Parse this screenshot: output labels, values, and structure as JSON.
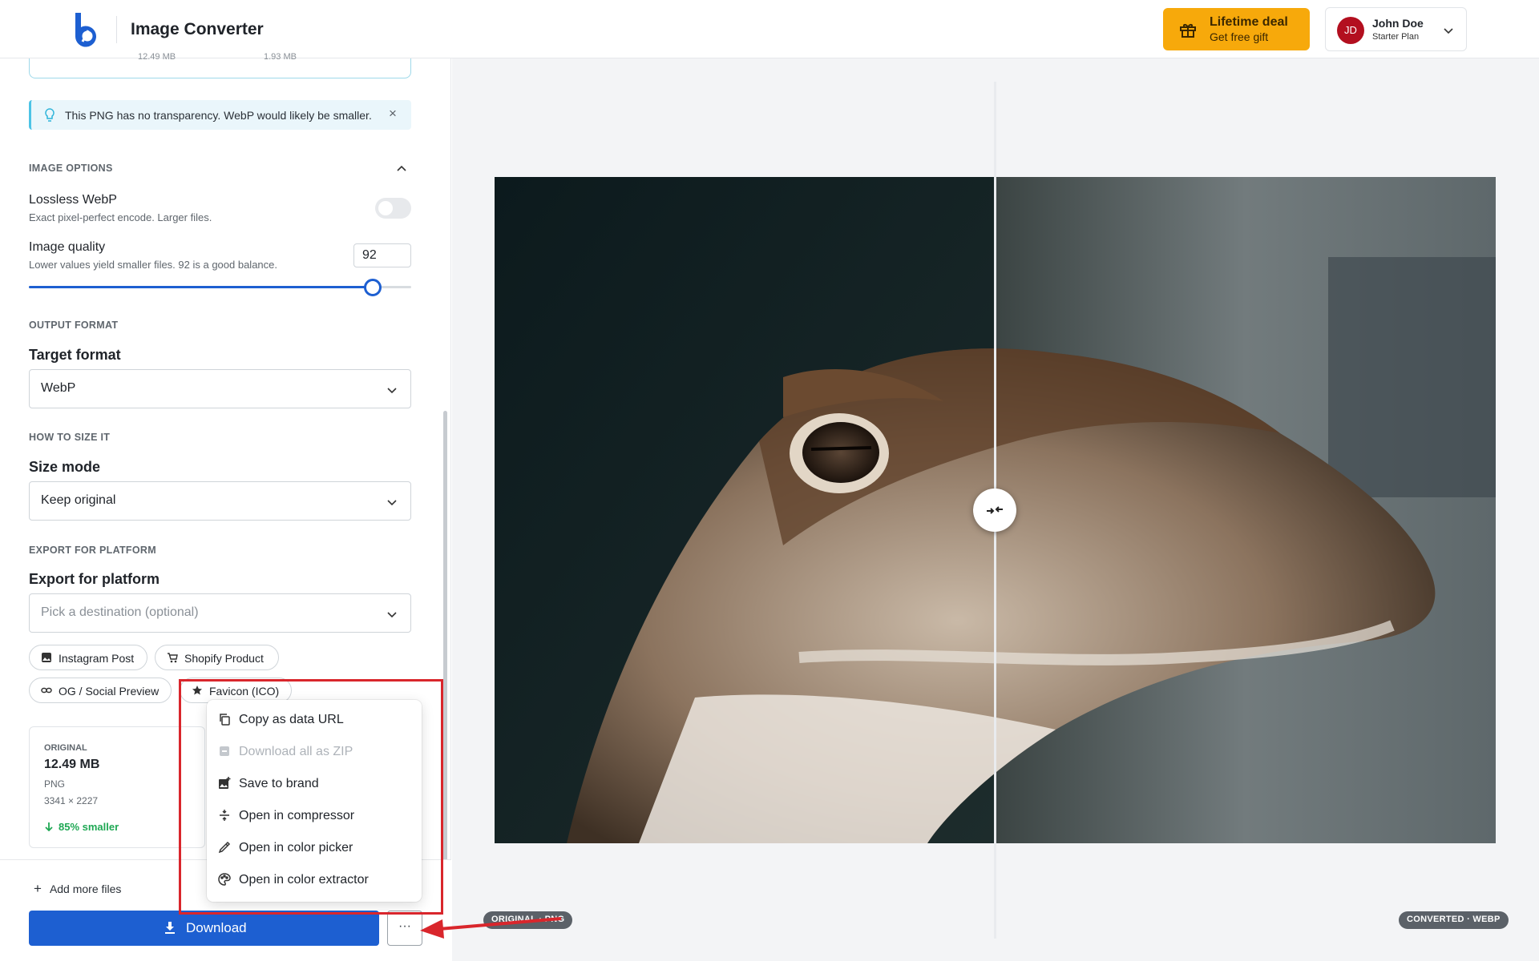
{
  "header": {
    "app_title": "Image Converter",
    "deal_title": "Lifetime deal",
    "deal_sub": "Get free gift",
    "user_initials": "JD",
    "user_name": "John Doe",
    "user_plan": "Starter Plan"
  },
  "stats_top": {
    "original": "12.49 MB",
    "converted": "1.93 MB"
  },
  "tip": {
    "text": "This PNG has no transparency. WebP would likely be smaller.",
    "close": "×"
  },
  "image_options": {
    "label": "IMAGE OPTIONS",
    "lossless_title": "Lossless WebP",
    "lossless_sub": "Exact pixel-perfect encode. Larger files.",
    "lossless_on": false,
    "quality_title": "Image quality",
    "quality_sub": "Lower values yield smaller files. 92 is a good balance.",
    "quality_value": "92",
    "quality_level": 0.92
  },
  "output_format": {
    "label": "OUTPUT FORMAT",
    "title": "Target format",
    "value": "WebP"
  },
  "size": {
    "label": "HOW TO SIZE IT",
    "title": "Size mode",
    "value": "Keep original"
  },
  "platform": {
    "label": "EXPORT FOR PLATFORM",
    "title": "Export for platform",
    "placeholder": "Pick a destination (optional)",
    "chips": [
      "Instagram Post",
      "Shopify Product",
      "OG / Social Preview",
      "Favicon (ICO)"
    ]
  },
  "original_card": {
    "label": "ORIGINAL",
    "size": "12.49 MB",
    "format": "PNG",
    "dimensions": "3341 × 2227",
    "savings": "85% smaller"
  },
  "actions": {
    "add_more": "Add more files",
    "download": "Download",
    "more": "···"
  },
  "menu": {
    "items": [
      {
        "label": "Copy as data URL",
        "icon": "copy-icon",
        "disabled": false
      },
      {
        "label": "Download all as ZIP",
        "icon": "archive-icon",
        "disabled": true
      },
      {
        "label": "Save to brand",
        "icon": "image-plus-icon",
        "disabled": false
      },
      {
        "label": "Open in compressor",
        "icon": "compress-icon",
        "disabled": false
      },
      {
        "label": "Open in color picker",
        "icon": "eyedropper-icon",
        "disabled": false
      },
      {
        "label": "Open in color extractor",
        "icon": "palette-icon",
        "disabled": false
      }
    ]
  },
  "preview": {
    "left_badge": "ORIGINAL · PNG",
    "right_badge": "CONVERTED · WEBP"
  },
  "colors": {
    "accent": "#1d5fd1",
    "deal": "#f7a90b",
    "avatar": "#b30f1f",
    "highlight": "#d9262c",
    "success": "#1fa854"
  }
}
